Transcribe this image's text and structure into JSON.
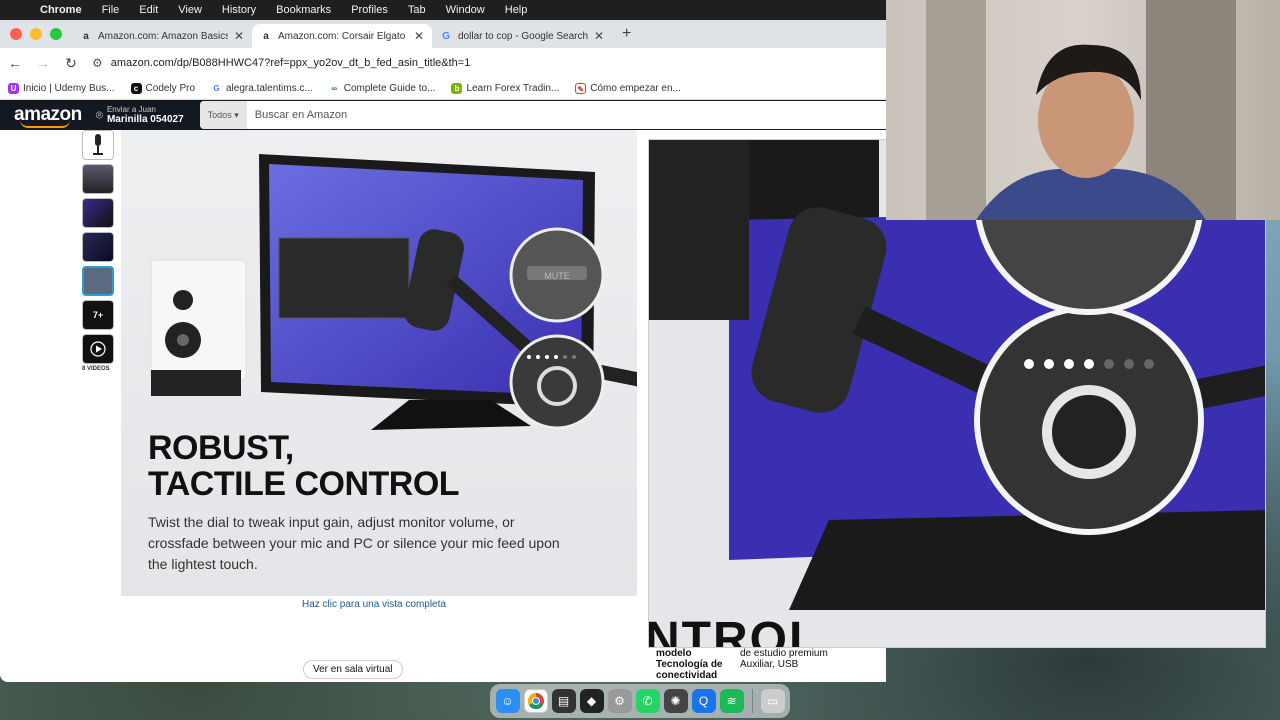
{
  "menubar": {
    "app": "Chrome",
    "items": [
      "File",
      "Edit",
      "View",
      "History",
      "Bookmarks",
      "Profiles",
      "Tab",
      "Window",
      "Help"
    ]
  },
  "tabs": [
    {
      "title": "Amazon.com: Amazon Basics",
      "icon": "a"
    },
    {
      "title": "Amazon.com: Corsair Elgato F",
      "icon": "a"
    },
    {
      "title": "dollar to cop - Google Search",
      "icon": "G"
    }
  ],
  "url": "amazon.com/dp/B088HHWC47?ref=ppx_yo2ov_dt_b_fed_asin_title&th=1",
  "bookmarks": [
    {
      "label": "Inicio | Udemy Bus...",
      "color": "#a435f0",
      "icon": "U"
    },
    {
      "label": "Codely Pro",
      "color": "#111111",
      "icon": "c"
    },
    {
      "label": "alegra.talentims.c...",
      "color": "#4285f4",
      "icon": "G"
    },
    {
      "label": "Complete Guide to...",
      "color": "#2e7d32",
      "icon": "∞"
    },
    {
      "label": "Learn Forex Tradin...",
      "color": "#7cb305",
      "icon": "b"
    },
    {
      "label": "Cómo empezar en...",
      "color": "#e53935",
      "icon": "✎"
    }
  ],
  "amazon": {
    "logo": "amazon",
    "deliver_line1": "Enviar a Juan",
    "deliver_line2": "Marinilla 054027",
    "search_category": "Todos",
    "search_placeholder": "Buscar en Amazon"
  },
  "product": {
    "thumb_more": "7+",
    "videos_label": "8 VIDEOS",
    "headline_line1": "ROBUST,",
    "headline_line2": "TACTILE CONTROL",
    "body": "Twist the dial to tweak input gain, adjust monitor volume, or crossfade between your mic and PC or silence your mic feed upon the lightest touch.",
    "mute_label": "MUTE",
    "view_full": "Haz clic para una vista completa",
    "virtual_view": "Ver en sala virtual",
    "zoom_text": "NTROL"
  },
  "specs": {
    "model_key": "modelo",
    "model_val": "de estudio premium",
    "conn_key": "Tecnología de conectividad",
    "conn_val": "Auxiliar, USB"
  }
}
